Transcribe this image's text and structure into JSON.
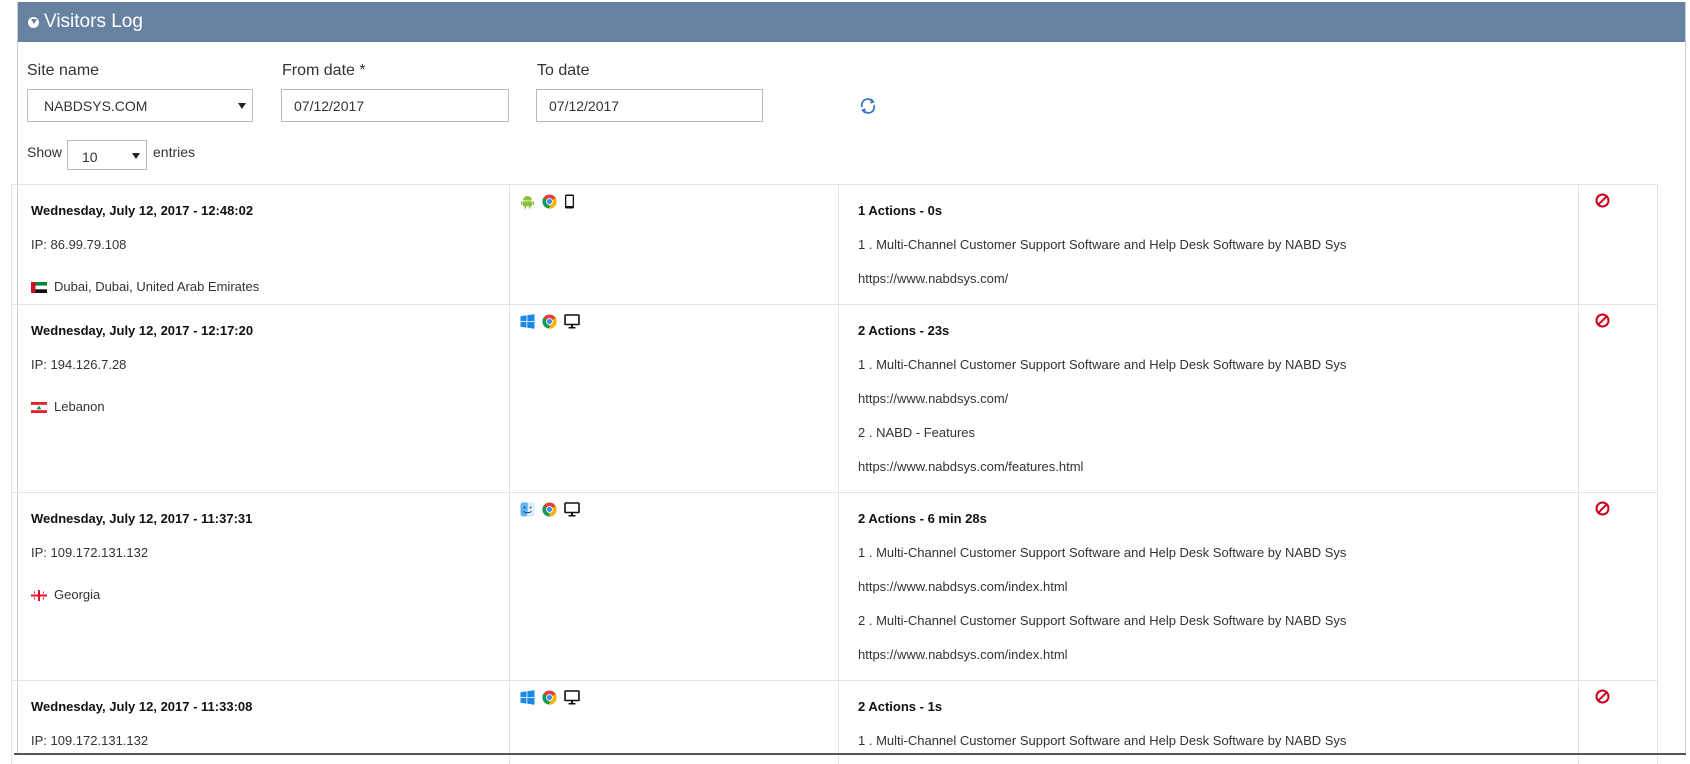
{
  "header": {
    "title": "Visitors Log",
    "icon": "chevron-down-circle-icon"
  },
  "filters": {
    "site_name_label": "Site name",
    "site_name_value": "NABDSYS.COM",
    "from_date_label": "From date *",
    "from_date_value": "07/12/2017",
    "to_date_label": "To date",
    "to_date_value": "07/12/2017",
    "refresh_icon": "refresh-icon"
  },
  "entries": {
    "show_label": "Show",
    "value": "10",
    "entries_label": "entries"
  },
  "rows": [
    {
      "datetime": "Wednesday, July 12, 2017 - 12:48:02",
      "ip": "IP: 86.99.79.108",
      "location": "Dubai, Dubai, United Arab Emirates",
      "flag": "uae-flag-icon",
      "os_icon": "android-icon",
      "browser_icon": "chrome-icon",
      "device_icon": "mobile-icon",
      "actions_title": "1 Actions - 0s",
      "actions": [
        {
          "title": "1 . Multi-Channel Customer Support Software and Help Desk Software by NABD Sys",
          "url": "https://www.nabdsys.com/"
        }
      ]
    },
    {
      "datetime": "Wednesday, July 12, 2017 - 12:17:20",
      "ip": "IP: 194.126.7.28",
      "location": "Lebanon",
      "flag": "lebanon-flag-icon",
      "os_icon": "windows-icon",
      "browser_icon": "chrome-icon",
      "device_icon": "desktop-icon",
      "actions_title": "2 Actions - 23s",
      "actions": [
        {
          "title": "1 . Multi-Channel Customer Support Software and Help Desk Software by NABD Sys",
          "url": "https://www.nabdsys.com/"
        },
        {
          "title": "2 . NABD - Features",
          "url": "https://www.nabdsys.com/features.html"
        }
      ]
    },
    {
      "datetime": "Wednesday, July 12, 2017 - 11:37:31",
      "ip": "IP: 109.172.131.132",
      "location": "Georgia",
      "flag": "georgia-flag-icon",
      "os_icon": "mac-finder-icon",
      "browser_icon": "chrome-icon",
      "device_icon": "desktop-icon",
      "actions_title": "2 Actions - 6 min 28s",
      "actions": [
        {
          "title": "1 . Multi-Channel Customer Support Software and Help Desk Software by NABD Sys",
          "url": "https://www.nabdsys.com/index.html"
        },
        {
          "title": "2 . Multi-Channel Customer Support Software and Help Desk Software by NABD Sys",
          "url": "https://www.nabdsys.com/index.html"
        }
      ]
    },
    {
      "datetime": "Wednesday, July 12, 2017 - 11:33:08",
      "ip": "IP: 109.172.131.132",
      "os_icon": "windows-icon",
      "browser_icon": "chrome-icon",
      "device_icon": "desktop-icon",
      "actions_title": "2 Actions - 1s",
      "actions": [
        {
          "title": "1 . Multi-Channel Customer Support Software and Help Desk Software by NABD Sys"
        }
      ]
    }
  ],
  "colors": {
    "header_bg": "#6781a1",
    "block_icon": "#d0021b",
    "refresh_icon": "#3b79c2"
  },
  "block_icon": "block-icon"
}
